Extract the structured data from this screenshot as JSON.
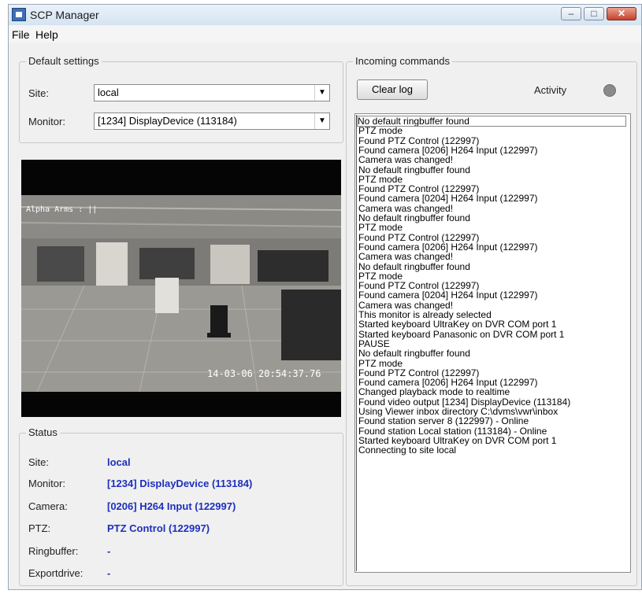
{
  "window": {
    "title": "SCP Manager"
  },
  "menu": {
    "file": "File",
    "help": "Help"
  },
  "default_settings": {
    "title": "Default settings",
    "site_label": "Site:",
    "site_value": "local",
    "monitor_label": "Monitor:",
    "monitor_value": "[1234] DisplayDevice (113184)"
  },
  "video": {
    "overlay_text": "Alpha Arms : ||",
    "timestamp": "14-03-06 20:54:37.76"
  },
  "status": {
    "title": "Status",
    "rows": [
      {
        "label": "Site:",
        "value": "local"
      },
      {
        "label": "Monitor:",
        "value": "[1234] DisplayDevice (113184)"
      },
      {
        "label": "Camera:",
        "value": "[0206] H264 Input (122997)"
      },
      {
        "label": "PTZ:",
        "value": "PTZ Control (122997)"
      },
      {
        "label": "Ringbuffer:",
        "value": "-"
      },
      {
        "label": "Exportdrive:",
        "value": "-"
      }
    ]
  },
  "incoming": {
    "title": "Incoming commands",
    "clear_button": "Clear log",
    "activity_label": "Activity",
    "log": [
      "No default ringbuffer found",
      "PTZ mode",
      "Found PTZ Control (122997)",
      "Found camera [0206] H264 Input (122997)",
      "Camera was changed!",
      "No default ringbuffer found",
      "PTZ mode",
      "Found PTZ Control (122997)",
      "Found camera [0204] H264 Input (122997)",
      "Camera was changed!",
      "No default ringbuffer found",
      "PTZ mode",
      "Found PTZ Control (122997)",
      "Found camera [0206] H264 Input (122997)",
      "Camera was changed!",
      "No default ringbuffer found",
      "PTZ mode",
      "Found PTZ Control (122997)",
      "Found camera [0204] H264 Input (122997)",
      "Camera was changed!",
      "This monitor is already selected",
      "Started keyboard UltraKey on DVR COM port 1",
      "Started keyboard Panasonic on DVR COM port 1",
      "PAUSE",
      "No default ringbuffer found",
      "PTZ mode",
      "Found PTZ Control (122997)",
      "Found camera [0206] H264 Input (122997)",
      "Changed playback mode to realtime",
      "Found video output [1234] DisplayDevice (113184)",
      "Using Viewer inbox directory C:\\dvms\\vwr\\inbox",
      "Found station server 8 (122997) - Online",
      "Found station Local station (113184) - Online",
      "Started keyboard UltraKey on DVR COM port 1",
      "Connecting to site local"
    ]
  },
  "colors": {
    "status_value": "#1c2fbe",
    "activity_led": "#8a8a8a"
  }
}
